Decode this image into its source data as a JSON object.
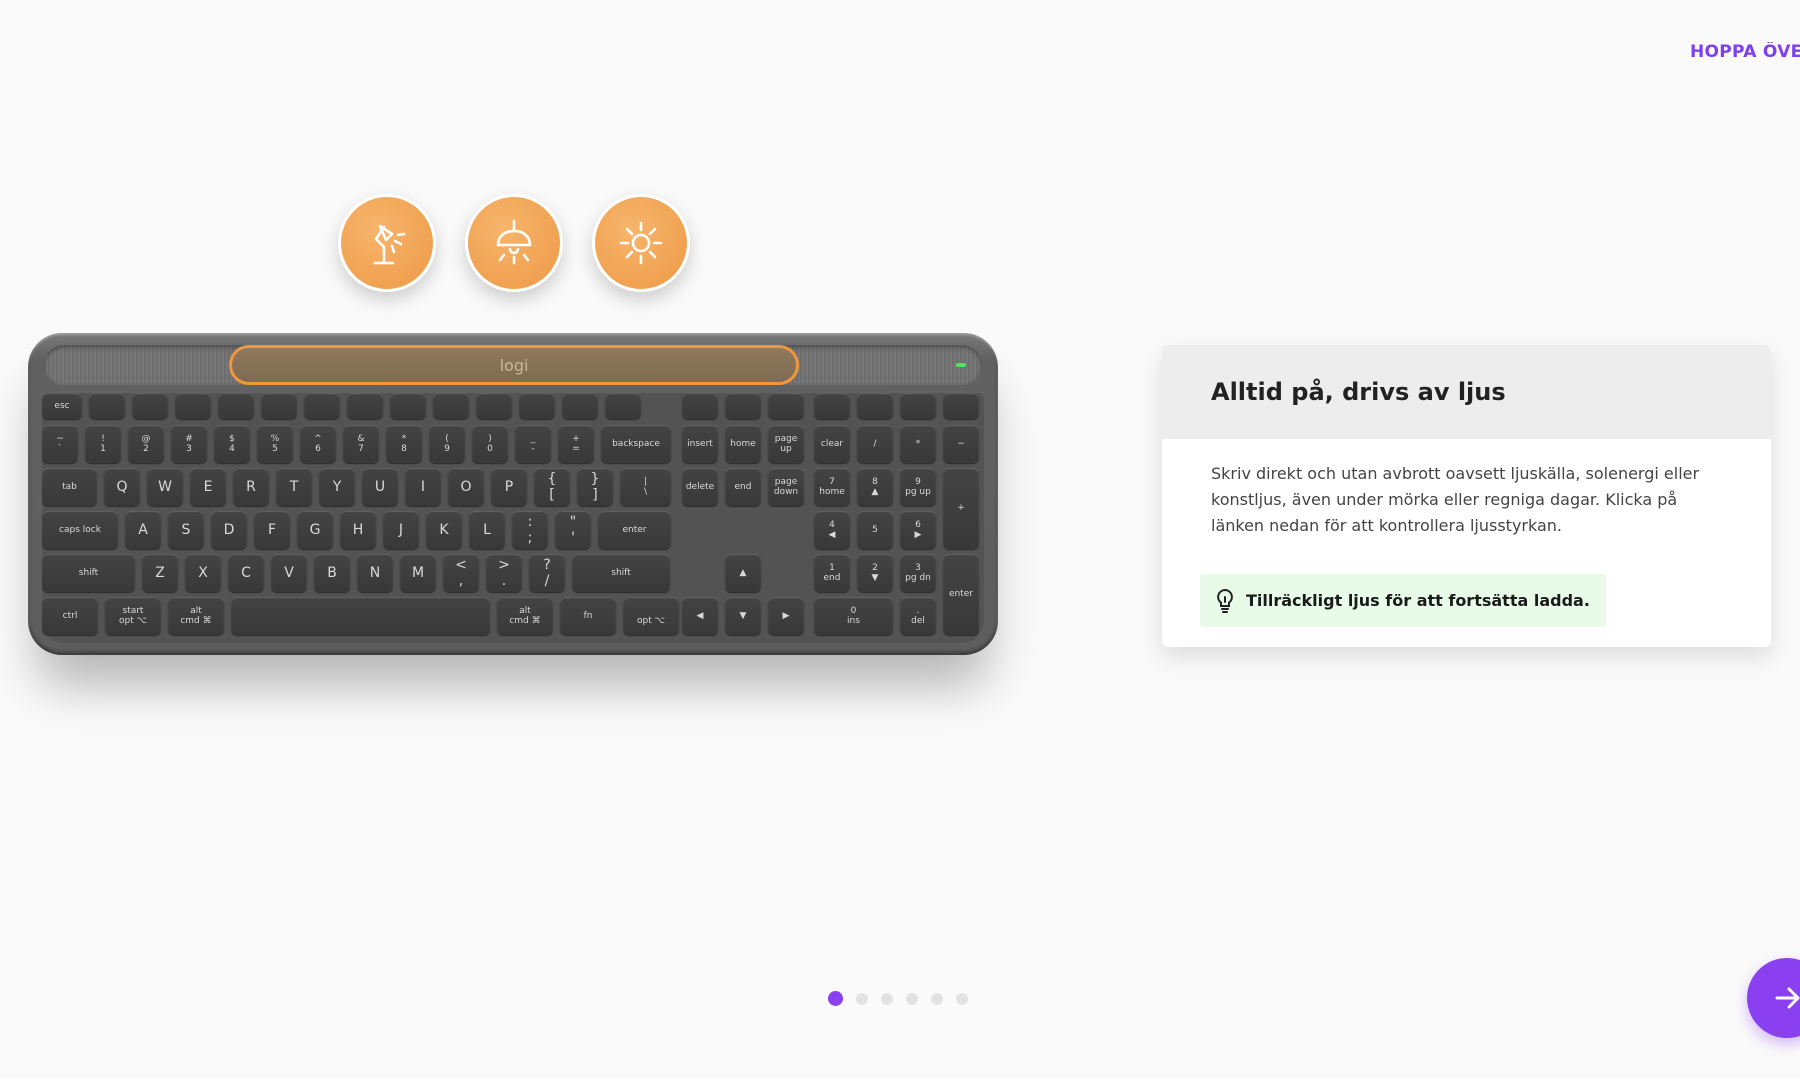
{
  "skip_label": "HOPPA ÖVER",
  "light_icons": [
    "desk-lamp-icon",
    "ceiling-lamp-icon",
    "sun-icon"
  ],
  "keyboard": {
    "logo": "logi",
    "keys": [
      [
        "esc",
        "",
        "",
        "",
        "",
        "",
        "",
        "",
        "",
        "",
        "",
        "",
        "",
        ""
      ],
      [
        "~\n`",
        "!\n1",
        "@\n2",
        "#\n3",
        "$\n4",
        "%\n5",
        "^\n6",
        "&\n7",
        "*\n8",
        "(\n9",
        ")\n0",
        "_\n-",
        "+\n=",
        "backspace"
      ],
      [
        "tab",
        "Q",
        "W",
        "E",
        "R",
        "T",
        "Y",
        "U",
        "I",
        "O",
        "P",
        "{\n[",
        "}\n]",
        "|\n\\"
      ],
      [
        "caps lock",
        "A",
        "S",
        "D",
        "F",
        "G",
        "H",
        "J",
        "K",
        "L",
        ":\n;",
        "\"\n'",
        "enter"
      ],
      [
        "shift",
        "Z",
        "X",
        "C",
        "V",
        "B",
        "N",
        "M",
        "<\n,",
        ">\n.",
        "?\n/",
        "shift"
      ],
      [
        "ctrl",
        "start\nopt ⌥",
        "alt\ncmd ⌘",
        "",
        "alt\ncmd ⌘",
        "fn",
        "\nopt ⌥"
      ]
    ],
    "nav_keys": [
      "insert",
      "home",
      "page\nup",
      "delete",
      "end",
      "page\ndown"
    ],
    "numpad": [
      "",
      "/",
      "*",
      "−",
      "7\nhome",
      "8\n▲",
      "9\npg up",
      "+",
      "4\n◀",
      "5",
      "6\n▶",
      "1\nend",
      "2\n▼",
      "3\npg dn",
      "enter",
      "0\nins",
      ".\ndel"
    ],
    "arrows": [
      "▲",
      "◀",
      "▼",
      "▶"
    ],
    "clear_label": "clear"
  },
  "card": {
    "title": "Alltid på, drivs av ljus",
    "body": "Skriv direkt och utan avbrott oavsett ljuskälla, solenergi eller konstljus, även under mörka eller regniga dagar. Klicka på länken nedan för att kontrollera ljusstyrkan.",
    "status": "Tillräckligt ljus för att fortsätta ladda.",
    "status_icon": "lightbulb-icon"
  },
  "pagination": {
    "total": 6,
    "active": 1
  },
  "next_icon": "arrow-right-icon",
  "colors": {
    "accent": "#8a3ff0",
    "orange": "#ee9944",
    "status_bg": "#e8fbe9"
  }
}
